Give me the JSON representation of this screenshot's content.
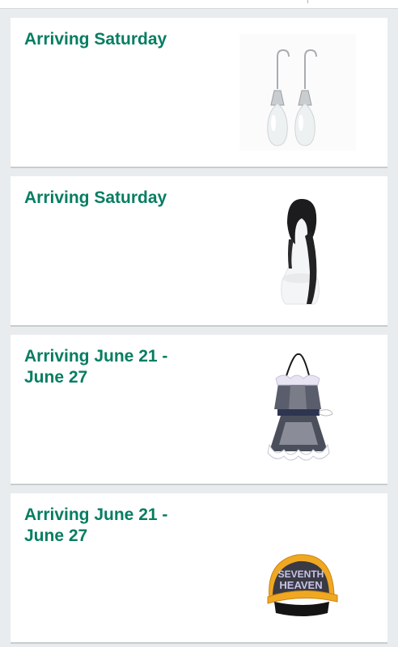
{
  "orders": [
    {
      "arrival": "Arriving Saturday",
      "product_icon": "earrings-image"
    },
    {
      "arrival": "Arriving Saturday",
      "product_icon": "wig-image"
    },
    {
      "arrival": "Arriving June 21 - June 27",
      "product_icon": "maid-outfit-image"
    },
    {
      "arrival": "Arriving June 21 - June 27",
      "product_icon": "cap-image",
      "product_text": [
        "SEVENTH",
        "HEAVEN"
      ]
    }
  ],
  "colors": {
    "arrival_text": "#067d62",
    "card_bg": "#ffffff",
    "page_bg": "#e9ecee"
  }
}
